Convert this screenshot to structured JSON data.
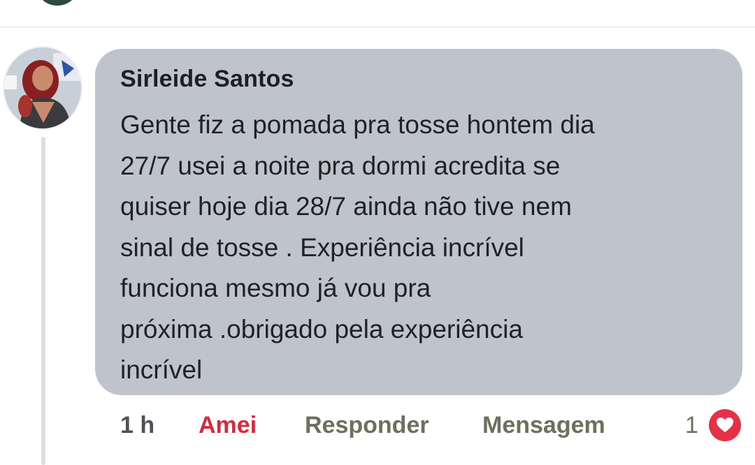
{
  "comment": {
    "author": "Sirleide Santos",
    "text": "Gente fiz a pomada pra tosse hontem dia\n27/7 usei a noite pra dormi acredita se\nquiser hoje dia 28/7 ainda não tive nem\nsinal de tosse . Experiência incrível\nfunciona mesmo já vou pra\npróxima .obrigado pela experiência\nincrível",
    "time": "1 h",
    "reaction_label": "Amei",
    "reply_label": "Responder",
    "message_label": "Mensagem",
    "reaction_count": "1"
  },
  "icons": {
    "reaction": "heart-icon",
    "avatar": "user-avatar"
  },
  "colors": {
    "bubble": "#bfc4cc",
    "reaction": "#e63045",
    "reaction_label": "#d5293e"
  }
}
